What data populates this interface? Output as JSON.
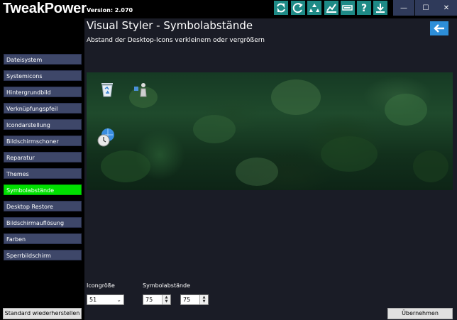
{
  "app": {
    "title": "TweakPower",
    "version": "Version: 2.070"
  },
  "toolbar": {
    "buttons": [
      {
        "icon": "refresh-icon"
      },
      {
        "icon": "redo-icon"
      },
      {
        "icon": "recycle-icon"
      },
      {
        "icon": "chart-icon"
      },
      {
        "icon": "battery-icon"
      },
      {
        "icon": "help-icon"
      },
      {
        "icon": "download-icon"
      }
    ]
  },
  "window": {
    "minimize": "—",
    "maximize": "☐",
    "close": "✕"
  },
  "sidebar": {
    "items": [
      {
        "label": "Dateisystem"
      },
      {
        "label": "Systemicons"
      },
      {
        "label": "Hintergrundbild"
      },
      {
        "label": "Verknüpfungspfeil"
      },
      {
        "label": "Icondarstellung"
      },
      {
        "label": "Bildschirmschoner"
      },
      {
        "label": "Reparatur"
      },
      {
        "label": "Themes"
      },
      {
        "label": "Symbolabstände",
        "active": true
      },
      {
        "label": "Desktop Restore"
      },
      {
        "label": "Bildschirmauflösung"
      },
      {
        "label": "Farben"
      },
      {
        "label": "Sperrbildschirm"
      }
    ]
  },
  "main": {
    "title": "Visual Styler - Symbolabstände",
    "subtitle": "Abstand der Desktop-Icons verkleinern oder vergrößern",
    "preview_icons": [
      "recycle-bin-icon",
      "network-icon",
      "globe-clock-icon"
    ]
  },
  "controls": {
    "icon_size_label": "Icongröße",
    "icon_size_value": "51",
    "spacing_label": "Symbolabstände",
    "spacing_h": "75",
    "spacing_v": "75"
  },
  "footer": {
    "restore_label": "Standard wiederherstellen",
    "apply_label": "Übernehmen"
  },
  "colors": {
    "accent_green": "#00e000",
    "toolbar_teal": "#1e8a86",
    "back_blue": "#2d8ed8"
  }
}
